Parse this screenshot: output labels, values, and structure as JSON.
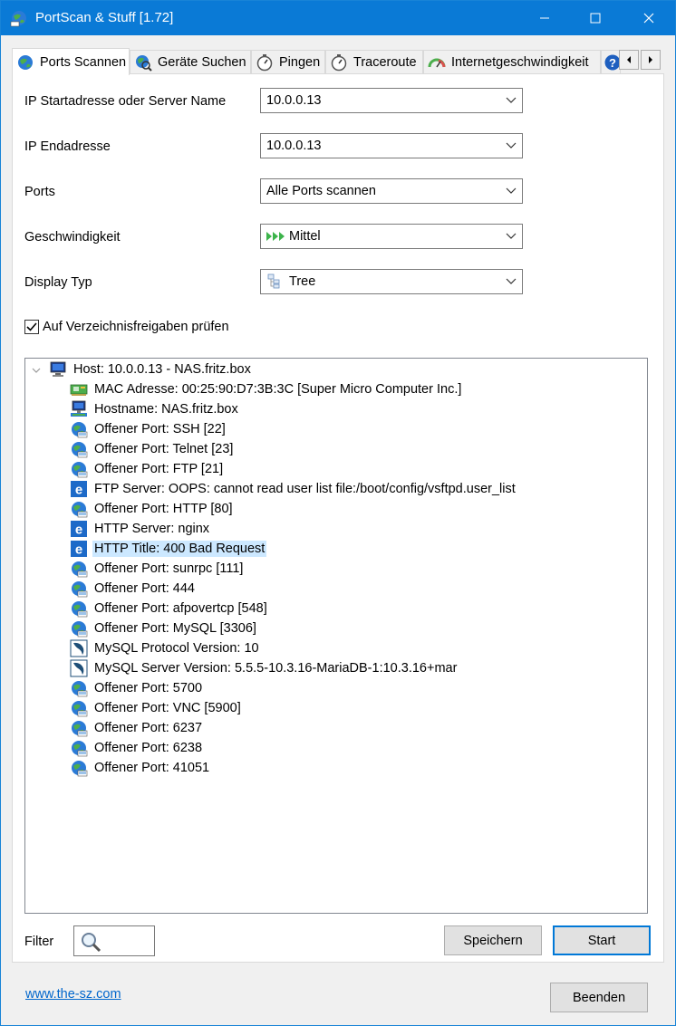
{
  "window": {
    "title": "PortScan & Stuff [1.72]",
    "accent": "#0a7ad6"
  },
  "tabs": [
    {
      "label": "Ports Scannen",
      "icon": "globe-icon",
      "active": true
    },
    {
      "label": "Geräte Suchen",
      "icon": "globe-search-icon"
    },
    {
      "label": "Pingen",
      "icon": "stopwatch-icon"
    },
    {
      "label": "Traceroute",
      "icon": "stopwatch-icon"
    },
    {
      "label": "Internetgeschwindigkeit",
      "icon": "speedometer-icon"
    },
    {
      "label": "",
      "icon": "help-icon"
    }
  ],
  "form": {
    "start_label": "IP Startadresse oder Server Name",
    "start_value": "10.0.0.13",
    "end_label": "IP Endadresse",
    "end_value": "10.0.0.13",
    "ports_label": "Ports",
    "ports_value": "Alle Ports scannen",
    "speed_label": "Geschwindigkeit",
    "speed_value": "Mittel",
    "display_label": "Display Typ",
    "display_value": "Tree",
    "share_check_label": "Auf Verzeichnisfreigaben prüfen",
    "share_check_checked": true
  },
  "tree": {
    "root": {
      "text": "Host: 10.0.0.13 - NAS.fritz.box",
      "icon": "computer-icon"
    },
    "children": [
      {
        "text": "MAC Adresse: 00:25:90:D7:3B:3C [Super Micro Computer Inc.]",
        "icon": "network-card-icon"
      },
      {
        "text": "Hostname: NAS.fritz.box",
        "icon": "network-computer-icon"
      },
      {
        "text": "Offener Port: SSH [22]",
        "icon": "globe-icon"
      },
      {
        "text": "Offener Port: Telnet [23]",
        "icon": "globe-icon"
      },
      {
        "text": "Offener Port: FTP [21]",
        "icon": "globe-icon"
      },
      {
        "text": "FTP Server: OOPS: cannot read user list file:/boot/config/vsftpd.user_list",
        "icon": "browser-e-icon"
      },
      {
        "text": "Offener Port: HTTP [80]",
        "icon": "globe-icon"
      },
      {
        "text": "HTTP Server: nginx",
        "icon": "browser-e-icon"
      },
      {
        "text": "HTTP Title: 400 Bad Request",
        "icon": "browser-e-icon",
        "selected": true
      },
      {
        "text": "Offener Port: sunrpc [111]",
        "icon": "globe-icon"
      },
      {
        "text": "Offener Port: 444",
        "icon": "globe-icon"
      },
      {
        "text": "Offener Port: afpovertcp [548]",
        "icon": "globe-icon"
      },
      {
        "text": "Offener Port: MySQL [3306]",
        "icon": "globe-icon"
      },
      {
        "text": "MySQL Protocol Version: 10",
        "icon": "mysql-dolphin-icon"
      },
      {
        "text": "MySQL Server Version: 5.5.5-10.3.16-MariaDB-1:10.3.16+mar",
        "icon": "mysql-dolphin-icon"
      },
      {
        "text": "Offener Port: 5700",
        "icon": "globe-icon"
      },
      {
        "text": "Offener Port: VNC [5900]",
        "icon": "globe-icon"
      },
      {
        "text": "Offener Port: 6237",
        "icon": "globe-icon"
      },
      {
        "text": "Offener Port: 6238",
        "icon": "globe-icon"
      },
      {
        "text": "Offener Port: 41051",
        "icon": "globe-icon"
      }
    ]
  },
  "bottom": {
    "filter_label": "Filter",
    "save_label": "Speichern",
    "start_label": "Start",
    "link_text": "www.the-sz.com",
    "exit_label": "Beenden"
  }
}
